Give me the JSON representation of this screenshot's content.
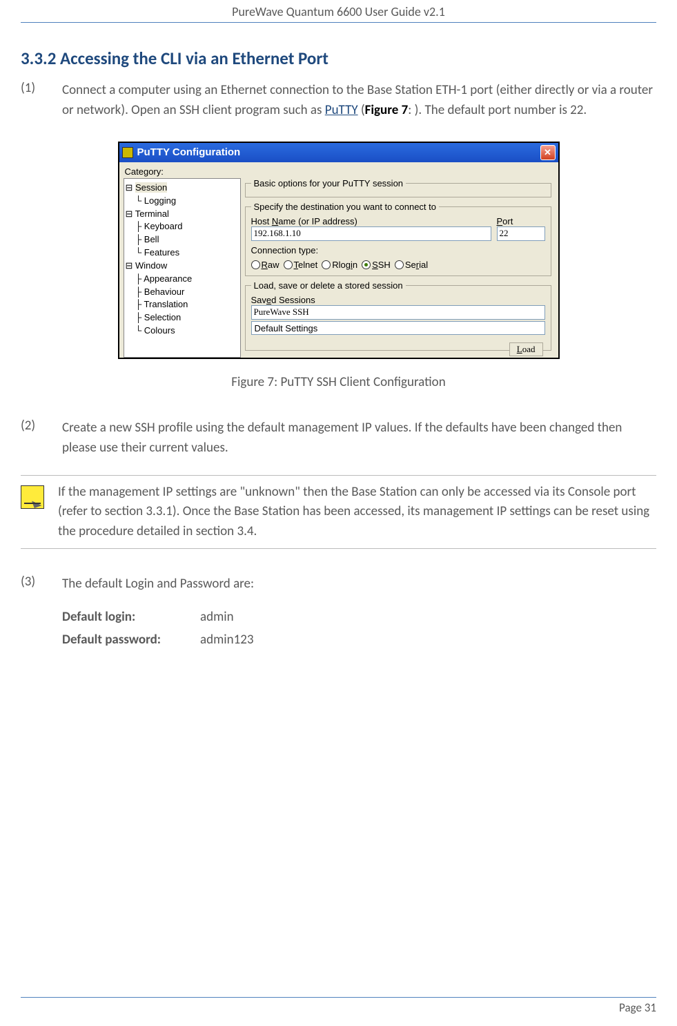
{
  "header": {
    "title": "PureWave Quantum 6600 User Guide v2.1"
  },
  "section": {
    "heading": "3.3.2 Accessing the CLI via an Ethernet Port"
  },
  "step1": {
    "num": "(1)",
    "text_a": "Connect a computer using an Ethernet connection to the Base Station ETH-1 port (either directly or via a router or network). Open an SSH client program such as ",
    "link": "PuTTY",
    "text_b": "  (",
    "figref": "Figure 7",
    "text_c": ": ). The default port number is 22."
  },
  "putty": {
    "title": "PuTTY Configuration",
    "category_label": "Category:",
    "tree": {
      "session": "Session",
      "logging": "Logging",
      "terminal": "Terminal",
      "keyboard": "Keyboard",
      "bell": "Bell",
      "features": "Features",
      "window": "Window",
      "appearance": "Appearance",
      "behaviour": "Behaviour",
      "translation": "Translation",
      "selection": "Selection",
      "colours": "Colours"
    },
    "basic_legend": "Basic options for your PuTTY session",
    "dest_legend": "Specify the destination you want to connect to",
    "host_label": "Host Name (or IP address)",
    "port_label": "Port",
    "host_value": "192.168.1.10",
    "port_value": "22",
    "conn_label": "Connection type:",
    "radios": {
      "raw": "Raw",
      "telnet": "Telnet",
      "rlogin": "Rlogin",
      "ssh": "SSH",
      "serial": "Serial"
    },
    "load_legend": "Load, save or delete a stored session",
    "saved_label": "Saved Sessions",
    "saved_value": "PureWave SSH",
    "default_settings": "Default Settings",
    "load_btn": "Load"
  },
  "caption": "Figure 7: PuTTY SSH Client Configuration",
  "step2": {
    "num": "(2)",
    "text": "Create a new SSH profile using the default management IP values. If the defaults have been changed then please use their current values."
  },
  "note": "If the management IP settings are \"unknown\" then the Base Station can only be accessed via its Console port (refer to section 3.3.1). Once the Base Station has been accessed, its management IP settings can be reset using the procedure detailed in section 3.4.",
  "step3": {
    "num": "(3)",
    "text": "The default Login and Password are:",
    "login_label": "Default login:",
    "login_value": "admin",
    "pwd_label": "Default password:",
    "pwd_value": "admin123"
  },
  "footer": {
    "page": "Page 31"
  }
}
